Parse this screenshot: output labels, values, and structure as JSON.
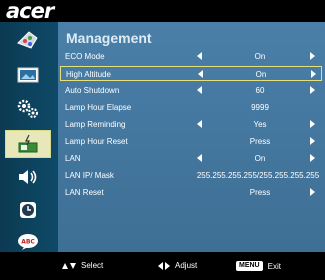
{
  "logo": "acer",
  "sidebar": {
    "items": [
      {
        "icon": "color-palette-icon"
      },
      {
        "icon": "picture-icon"
      },
      {
        "icon": "settings-gears-icon"
      },
      {
        "icon": "lamp-management-icon",
        "active": true
      },
      {
        "icon": "speaker-icon"
      },
      {
        "icon": "clock-icon"
      },
      {
        "icon": "language-abc-icon"
      }
    ]
  },
  "panel": {
    "title": "Management",
    "rows": [
      {
        "label": "ECO Mode",
        "value": "On",
        "left_arrow": true,
        "right_arrow": true
      },
      {
        "label": "High Altitude",
        "value": "On",
        "left_arrow": true,
        "right_arrow": true,
        "selected": true
      },
      {
        "label": "Auto Shutdown",
        "value": "60",
        "left_arrow": true,
        "right_arrow": true
      },
      {
        "label": "Lamp Hour Elapse",
        "value": "9999",
        "left_arrow": false,
        "right_arrow": false
      },
      {
        "label": "Lamp Reminding",
        "value": "Yes",
        "left_arrow": true,
        "right_arrow": true
      },
      {
        "label": "Lamp Hour Reset",
        "value": "Press",
        "left_arrow": false,
        "right_arrow": true
      },
      {
        "label": "LAN",
        "value": "On",
        "left_arrow": true,
        "right_arrow": true
      },
      {
        "label": "LAN IP/ Mask",
        "value": "255.255.255.255/255.255.255.255",
        "left_arrow": false,
        "right_arrow": false
      },
      {
        "label": "LAN Reset",
        "value": "Press",
        "left_arrow": false,
        "right_arrow": true
      }
    ]
  },
  "footer": {
    "select_label": "Select",
    "adjust_label": "Adjust",
    "menu_key": "MENU",
    "exit_label": "Exit"
  }
}
